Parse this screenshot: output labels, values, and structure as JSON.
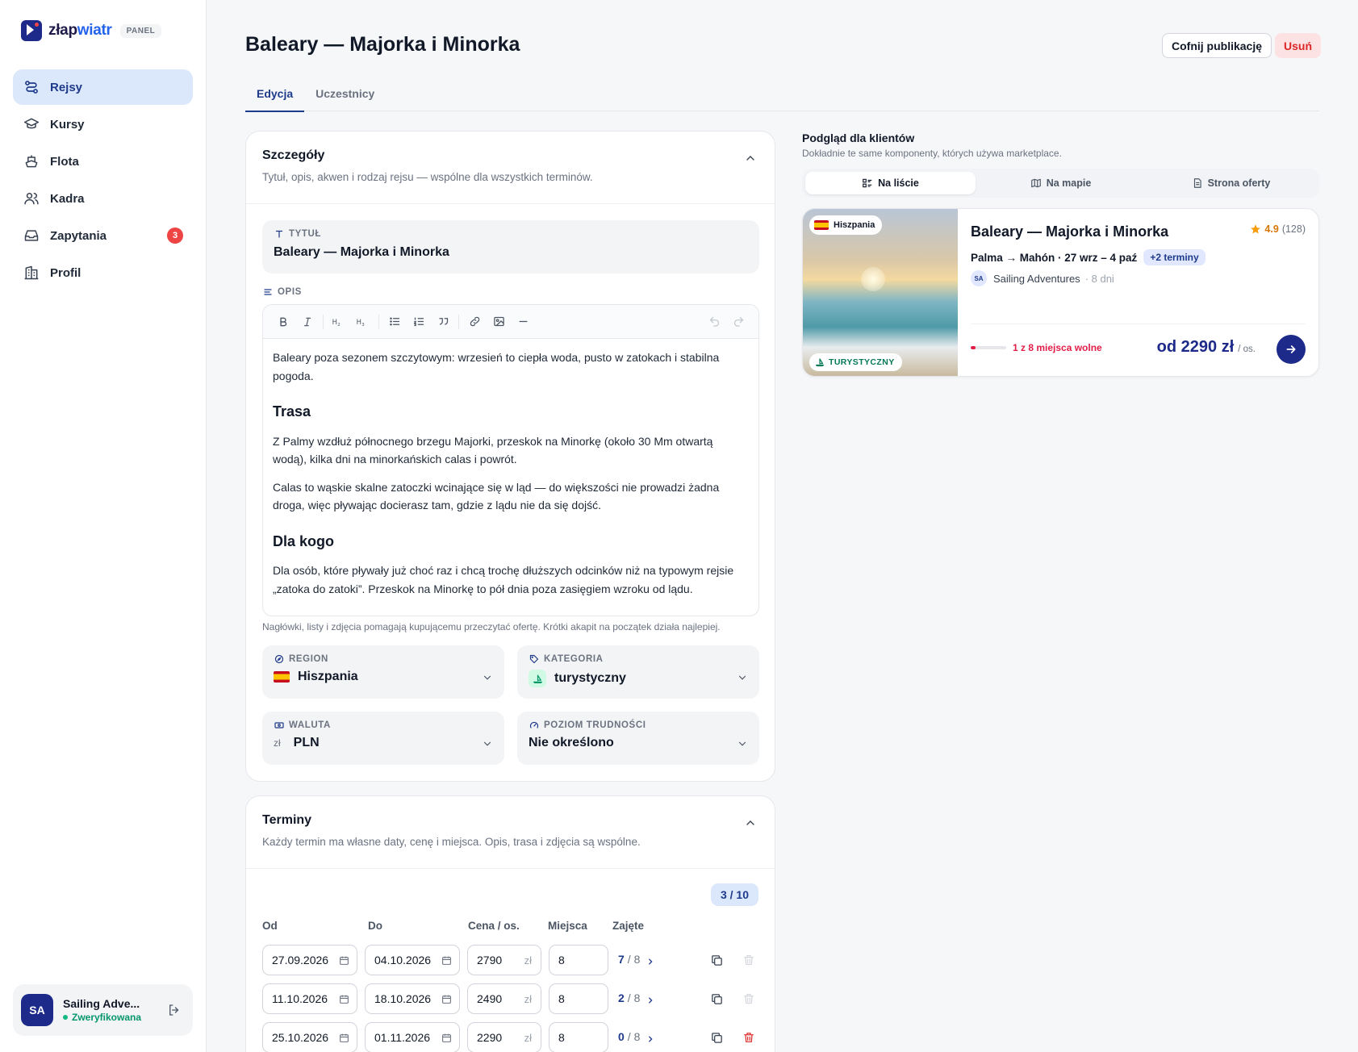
{
  "brand": {
    "prefix": "złap",
    "suffix": "wiatr",
    "badge": "PANEL"
  },
  "nav": [
    {
      "label": "Rejsy",
      "icon": "route-icon",
      "active": true
    },
    {
      "label": "Kursy",
      "icon": "graduation-cap-icon"
    },
    {
      "label": "Flota",
      "icon": "ship-icon"
    },
    {
      "label": "Kadra",
      "icon": "users-icon"
    },
    {
      "label": "Zapytania",
      "icon": "inbox-icon",
      "badge": "3"
    },
    {
      "label": "Profil",
      "icon": "building-icon"
    }
  ],
  "user": {
    "initials": "SA",
    "name": "Sailing Adve...",
    "status": "Zweryfikowana"
  },
  "header": {
    "title": "Baleary — Majorka i Minorka",
    "unpublish": "Cofnij publikację",
    "delete": "Usuń"
  },
  "tabs": [
    {
      "label": "Edycja",
      "active": true
    },
    {
      "label": "Uczestnicy"
    }
  ],
  "details": {
    "title": "Szczegóły",
    "subtitle": "Tytuł, opis, akwen i rodzaj rejsu — wspólne dla wszystkich terminów.",
    "title_label": "TYTUŁ",
    "title_value": "Baleary — Majorka i Minorka",
    "desc_label": "OPIS",
    "editor": {
      "p1": "Baleary poza sezonem szczytowym: wrzesień to ciepła woda, pusto w zatokach i stabilna pogoda.",
      "h1": "Trasa",
      "p2": "Z Palmy wzdłuż północnego brzegu Majorki, przeskok na Minorkę (około 30 Mm otwartą wodą), kilka dni na minorkańskich calas i powrót.",
      "p3": "Calas to wąskie skalne zatoczki wcinające się w ląd — do większości nie prowadzi żadna droga, więc pływając docierasz tam, gdzie z lądu nie da się dojść.",
      "h2": "Dla kogo",
      "p4": "Dla osób, które pływały już choć raz i chcą trochę dłuższych odcinków niż na typowym rejsie „zatoka do zatoki”. Przeskok na Minorkę to pół dnia poza zasięgiem wzroku od lądu."
    },
    "hint": "Nagłówki, listy i zdjęcia pomagają kupującemu przeczytać ofertę. Krótki akapit na początek działa najlepiej.",
    "region": {
      "label": "REGION",
      "value": "Hiszpania"
    },
    "category": {
      "label": "KATEGORIA",
      "value": "turystyczny"
    },
    "currency": {
      "label": "WALUTA",
      "symbol": "zł",
      "value": "PLN"
    },
    "difficulty": {
      "label": "POZIOM TRUDNOŚCI",
      "value": "Nie określono"
    }
  },
  "dates": {
    "title": "Terminy",
    "subtitle": "Każdy termin ma własne daty, cenę i miejsca. Opis, trasa i zdjęcia są wspólne.",
    "count": "3 / 10",
    "headers": {
      "from": "Od",
      "to": "Do",
      "price": "Cena / os.",
      "seats": "Miejsca",
      "taken": "Zajęte"
    },
    "currency": "zł",
    "rows": [
      {
        "from": "27.09.2026",
        "to": "04.10.2026",
        "price": "2790",
        "seats": "8",
        "taken": "7",
        "total": "/ 8"
      },
      {
        "from": "11.10.2026",
        "to": "18.10.2026",
        "price": "2490",
        "seats": "8",
        "taken": "2",
        "total": "/ 8"
      },
      {
        "from": "25.10.2026",
        "to": "01.11.2026",
        "price": "2290",
        "seats": "8",
        "taken": "0",
        "total": "/ 8"
      }
    ]
  },
  "preview": {
    "title": "Podgląd dla klientów",
    "subtitle": "Dokładnie te same komponenty, których używa marketplace.",
    "modes": [
      {
        "label": "Na liście",
        "active": true
      },
      {
        "label": "Na mapie"
      },
      {
        "label": "Strona oferty"
      }
    ],
    "card": {
      "country": "Hiszpania",
      "category": "TURYSTYCZNY",
      "title": "Baleary — Majorka i Minorka",
      "rating": "4.9",
      "reviews": "(128)",
      "route": "Palma → Mahón · 27 wrz – 4 paź",
      "more": "+2 terminy",
      "org_initials": "SA",
      "organizer": "Sailing Adventures",
      "duration": "· 8 dni",
      "availability": "1 z 8 miejsca wolne",
      "availability_fraction": 0.125,
      "price": "od 2290 zł",
      "per": "/ os."
    }
  },
  "colors": {
    "primary": "#1e2a8a",
    "accent": "#dbe7fb",
    "danger": "#dc2626",
    "success": "#059669"
  }
}
